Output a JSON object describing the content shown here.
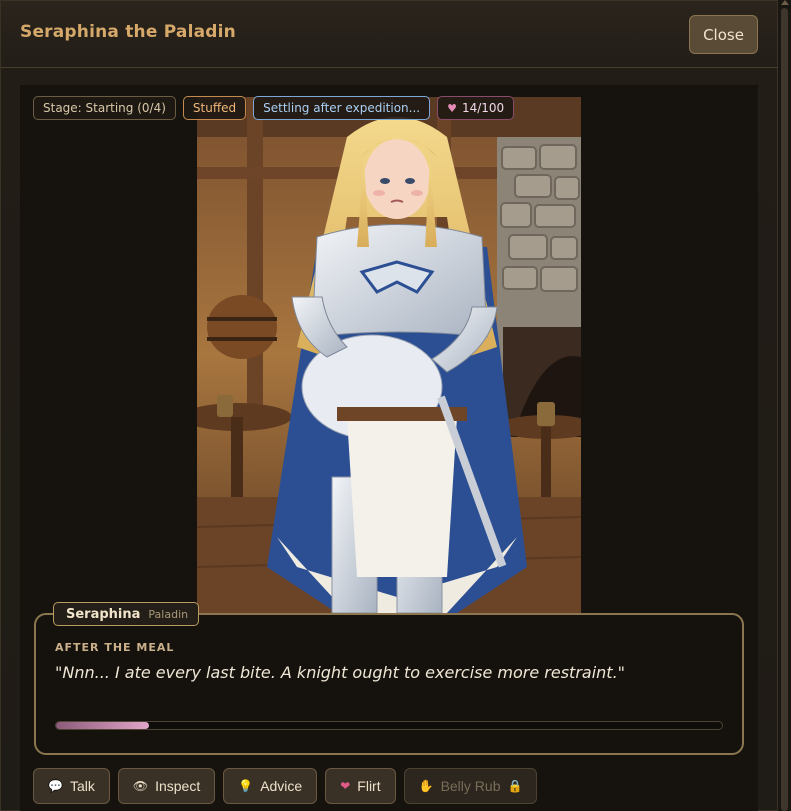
{
  "window": {
    "title": "Seraphina the Paladin",
    "close_label": "Close"
  },
  "badges": {
    "stage": "Stage: Starting (0/4)",
    "mood": "Stuffed",
    "status": "Settling after expedition...",
    "affection": "14/100"
  },
  "dialog": {
    "name": "Seraphina",
    "class": "Paladin",
    "scene": "AFTER THE MEAL",
    "quote": "\"Nnn... I ate every last bite. A knight ought to exercise more restraint.\"",
    "progress": 0.14
  },
  "actions": [
    {
      "label": "Talk",
      "icon": "speech-bubble-icon",
      "enabled": true
    },
    {
      "label": "Inspect",
      "icon": "eye-icon",
      "enabled": true
    },
    {
      "label": "Advice",
      "icon": "lightbulb-icon",
      "enabled": true
    },
    {
      "label": "Flirt",
      "icon": "heart-icon",
      "enabled": true
    },
    {
      "label": "Belly Rub",
      "icon": "hand-icon",
      "enabled": false,
      "locked": true
    }
  ],
  "colors": {
    "accent": "#d6a96a",
    "affection": "#e48ab6",
    "status": "#7ea7d9",
    "mood": "#c48a4d"
  }
}
